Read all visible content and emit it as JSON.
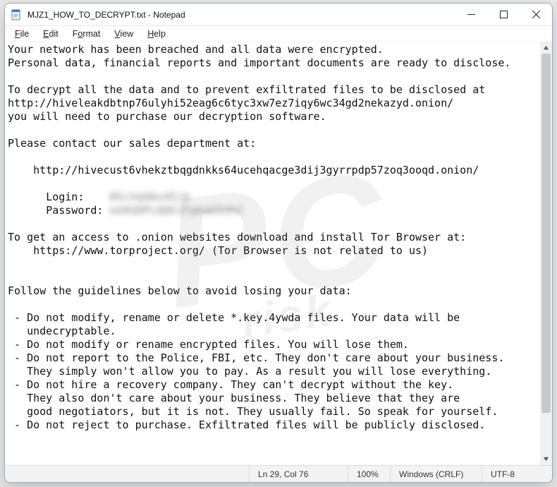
{
  "titlebar": {
    "title": "MJZ1_HOW_TO_DECRYPT.txt - Notepad"
  },
  "menu": {
    "file": "File",
    "edit": "Edit",
    "format": "Format",
    "view": "View",
    "help": "Help"
  },
  "text": {
    "l1": "Your network has been breached and all data were encrypted.",
    "l2": "Personal data, financial reports and important documents are ready to disclose.",
    "l3": "",
    "l4": "To decrypt all the data and to prevent exfiltrated files to be disclosed at",
    "l5": "http://hiveleakdbtnp76ulyhi52eag6c6tyc3xw7ez7iqy6wc34gd2nekazyd.onion/",
    "l6": "you will need to purchase our decryption software.",
    "l7": "",
    "l8": "Please contact our sales department at:",
    "l9": "",
    "l10": "    http://hivecust6vhekztbqgdnkks64ucehqacge3dij3gyrrpdp57zoq3ooqd.onion/",
    "l11": "",
    "l12p": "      Login:    ",
    "l12b": "85cVq9Av45jb",
    "l13p": "      Password: ",
    "l13b": "ed4GDPLQQh1FpbaG5XhC",
    "l14": "",
    "l15": "To get an access to .onion websites download and install Tor Browser at:",
    "l16": "    https://www.torproject.org/ (Tor Browser is not related to us)",
    "l17": "",
    "l18": "",
    "l19": "Follow the guidelines below to avoid losing your data:",
    "l20": "",
    "l21": " - Do not modify, rename or delete *.key.4ywda files. Your data will be",
    "l22": "   undecryptable.",
    "l23": " - Do not modify or rename encrypted files. You will lose them.",
    "l24": " - Do not report to the Police, FBI, etc. They don't care about your business.",
    "l25": "   They simply won't allow you to pay. As a result you will lose everything.",
    "l26": " - Do not hire a recovery company. They can't decrypt without the key.",
    "l27": "   They also don't care about your business. They believe that they are",
    "l28": "   good negotiators, but it is not. They usually fail. So speak for yourself.",
    "l29": " - Do not reject to purchase. Exfiltrated files will be publicly disclosed."
  },
  "status": {
    "position": "Ln 29, Col 76",
    "zoom": "100%",
    "eol": "Windows (CRLF)",
    "encoding": "UTF-8"
  },
  "watermark": {
    "line1": "PC",
    "line2": "risk"
  }
}
